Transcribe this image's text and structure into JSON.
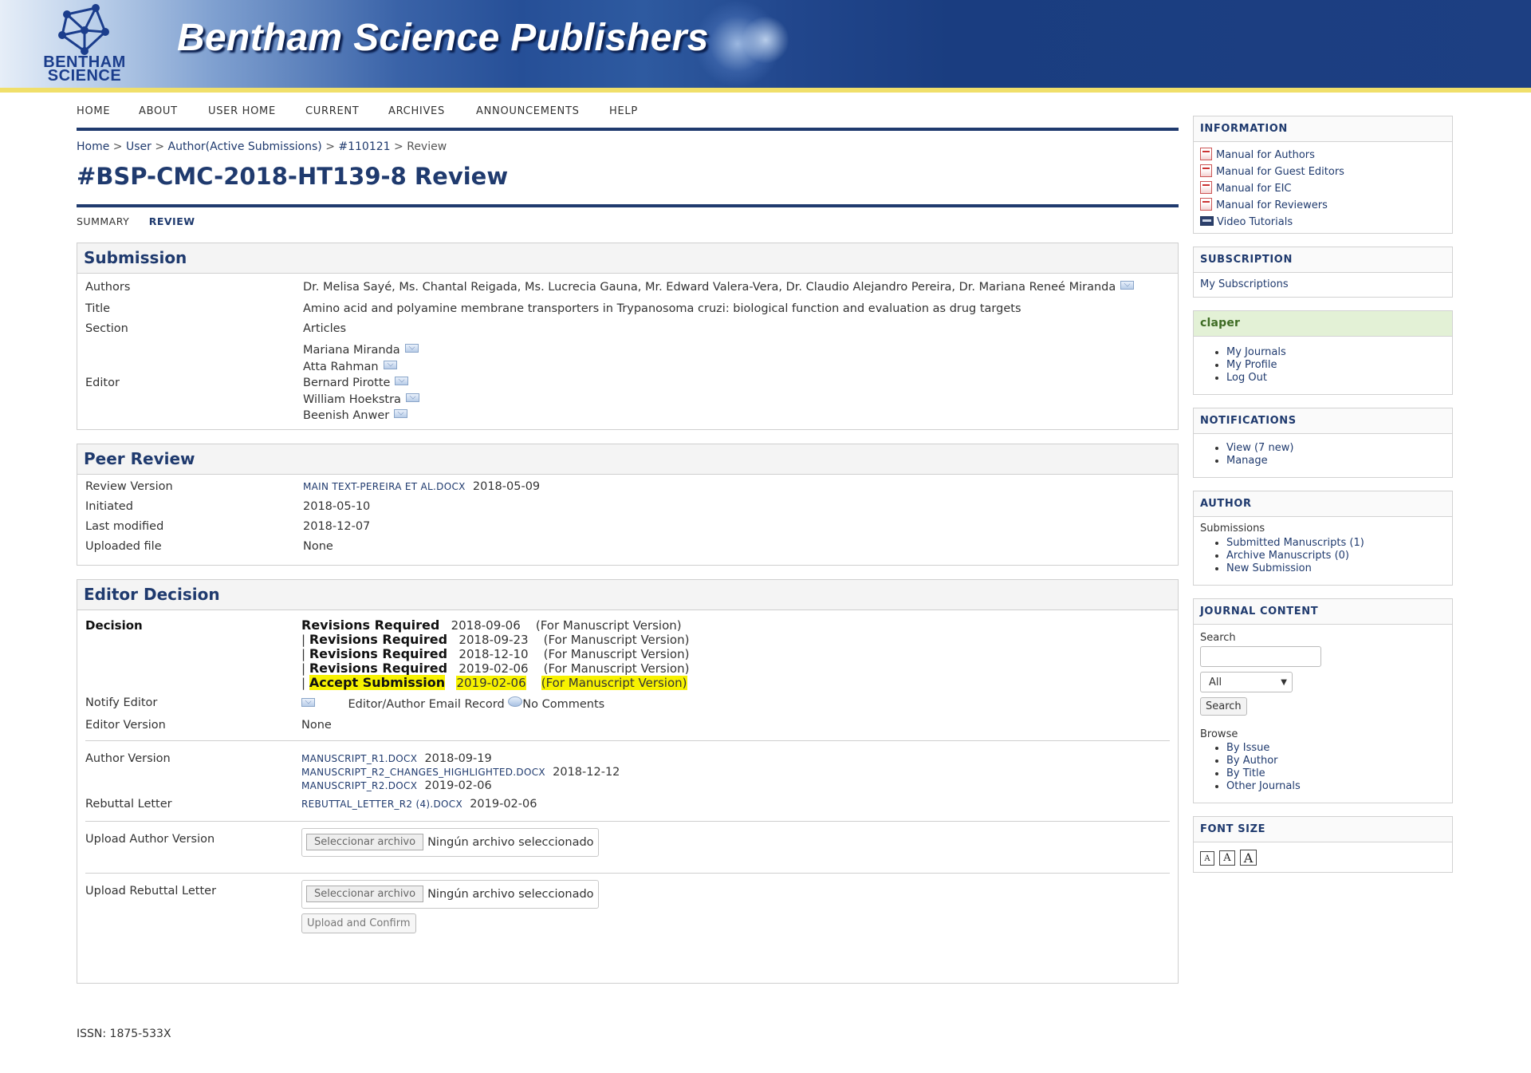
{
  "banner": {
    "logo_line1": "BENTHAM",
    "logo_line2": "SCIENCE",
    "title": "Bentham Science Publishers"
  },
  "nav": {
    "home": "HOME",
    "about": "ABOUT",
    "user_home": "USER HOME",
    "current": "CURRENT",
    "archives": "ARCHIVES",
    "announcements": "ANNOUNCEMENTS",
    "help": "HELP"
  },
  "breadcrumb": {
    "home": "Home",
    "sep": ">",
    "user": "User",
    "author": "Author(Active Submissions)",
    "id": "#110121",
    "current": "Review"
  },
  "page_title": "#BSP-CMC-2018-HT139-8 Review",
  "tabs": {
    "summary": "SUMMARY",
    "review": "REVIEW"
  },
  "submission": {
    "heading": "Submission",
    "authors_label": "Authors",
    "authors": "Dr. Melisa Sayé, Ms. Chantal Reigada, Ms. Lucrecia Gauna, Mr. Edward Valera-Vera, Dr. Claudio Alejandro Pereira, Dr. Mariana Reneé Miranda",
    "title_label": "Title",
    "title": "Amino acid and polyamine membrane transporters in Trypanosoma cruzi: biological function and evaluation as drug targets",
    "section_label": "Section",
    "section": "Articles",
    "editor_label": "Editor",
    "editors": [
      "Mariana Miranda",
      "Atta Rahman",
      "Bernard Pirotte",
      "William Hoekstra",
      "Beenish Anwer"
    ]
  },
  "peer_review": {
    "heading": "Peer Review",
    "review_version_label": "Review Version",
    "review_file": "MAIN TEXT-PEREIRA ET AL.DOCX",
    "review_date": "2018-05-09",
    "initiated_label": "Initiated",
    "initiated": "2018-05-10",
    "last_modified_label": "Last modified",
    "last_modified": "2018-12-07",
    "uploaded_label": "Uploaded file",
    "uploaded": "None"
  },
  "editor_decision": {
    "heading": "Editor Decision",
    "decision_label": "Decision",
    "decisions": [
      {
        "prefix": "",
        "label": "Revisions Required",
        "date": "2018-09-06",
        "note": "(For Manuscript Version)"
      },
      {
        "prefix": "| ",
        "label": "Revisions Required",
        "date": "2018-09-23",
        "note": "(For Manuscript Version)"
      },
      {
        "prefix": "| ",
        "label": "Revisions Required",
        "date": "2018-12-10",
        "note": "(For Manuscript Version)"
      },
      {
        "prefix": "| ",
        "label": "Revisions Required",
        "date": "2019-02-06",
        "note": "(For Manuscript Version)"
      },
      {
        "prefix": "| ",
        "label": "Accept Submission",
        "date": "2019-02-06",
        "note": "(For Manuscript Version)"
      }
    ],
    "notify_label": "Notify Editor",
    "email_record": "Editor/Author Email Record",
    "no_comments": "No Comments",
    "editor_version_label": "Editor Version",
    "editor_version": "None",
    "author_version_label": "Author Version",
    "author_files": [
      {
        "name": "MANUSCRIPT_R1.DOCX",
        "date": "2018-09-19"
      },
      {
        "name": "MANUSCRIPT_R2_CHANGES_HIGHLIGHTED.DOCX",
        "date": "2018-12-12"
      },
      {
        "name": "MANUSCRIPT_R2.DOCX",
        "date": "2019-02-06"
      }
    ],
    "rebuttal_label": "Rebuttal Letter",
    "rebuttal_file": "REBUTTAL_LETTER_R2 (4).DOCX",
    "rebuttal_date": "2019-02-06",
    "upload_author_label": "Upload Author Version",
    "upload_rebuttal_label": "Upload Rebuttal Letter",
    "choose_file": "Seleccionar archivo",
    "no_file": "Ningún archivo seleccionado",
    "upload_confirm": "Upload and Confirm"
  },
  "footer": {
    "issn": "ISSN: 1875-533X"
  },
  "sidebar": {
    "information": {
      "heading": "INFORMATION",
      "items": [
        "Manual for Authors",
        "Manual for Guest Editors",
        "Manual for EIC",
        "Manual for Reviewers",
        "Video Tutorials"
      ]
    },
    "subscription": {
      "heading": "SUBSCRIPTION",
      "link": "My Subscriptions"
    },
    "user": {
      "heading": "claper",
      "items": [
        "My Journals",
        "My Profile",
        "Log Out"
      ]
    },
    "notifications": {
      "heading": "NOTIFICATIONS",
      "items": [
        "View (7 new)",
        "Manage"
      ]
    },
    "author": {
      "heading": "AUTHOR",
      "submissions_label": "Submissions",
      "items": [
        "Submitted Manuscripts (1)",
        "Archive Manuscripts (0)",
        "New Submission"
      ]
    },
    "journal_content": {
      "heading": "JOURNAL CONTENT",
      "search_label": "Search",
      "scope_selected": "All",
      "search_button": "Search",
      "browse_label": "Browse",
      "browse_items": [
        "By Issue",
        "By Author",
        "By Title",
        "Other Journals"
      ]
    },
    "font_size": {
      "heading": "FONT SIZE",
      "glyph": "A"
    }
  },
  "colors": {
    "brand_navy": "#1f3a6e",
    "highlight": "#f7f200",
    "banner_stripe": "#f0df6a"
  }
}
